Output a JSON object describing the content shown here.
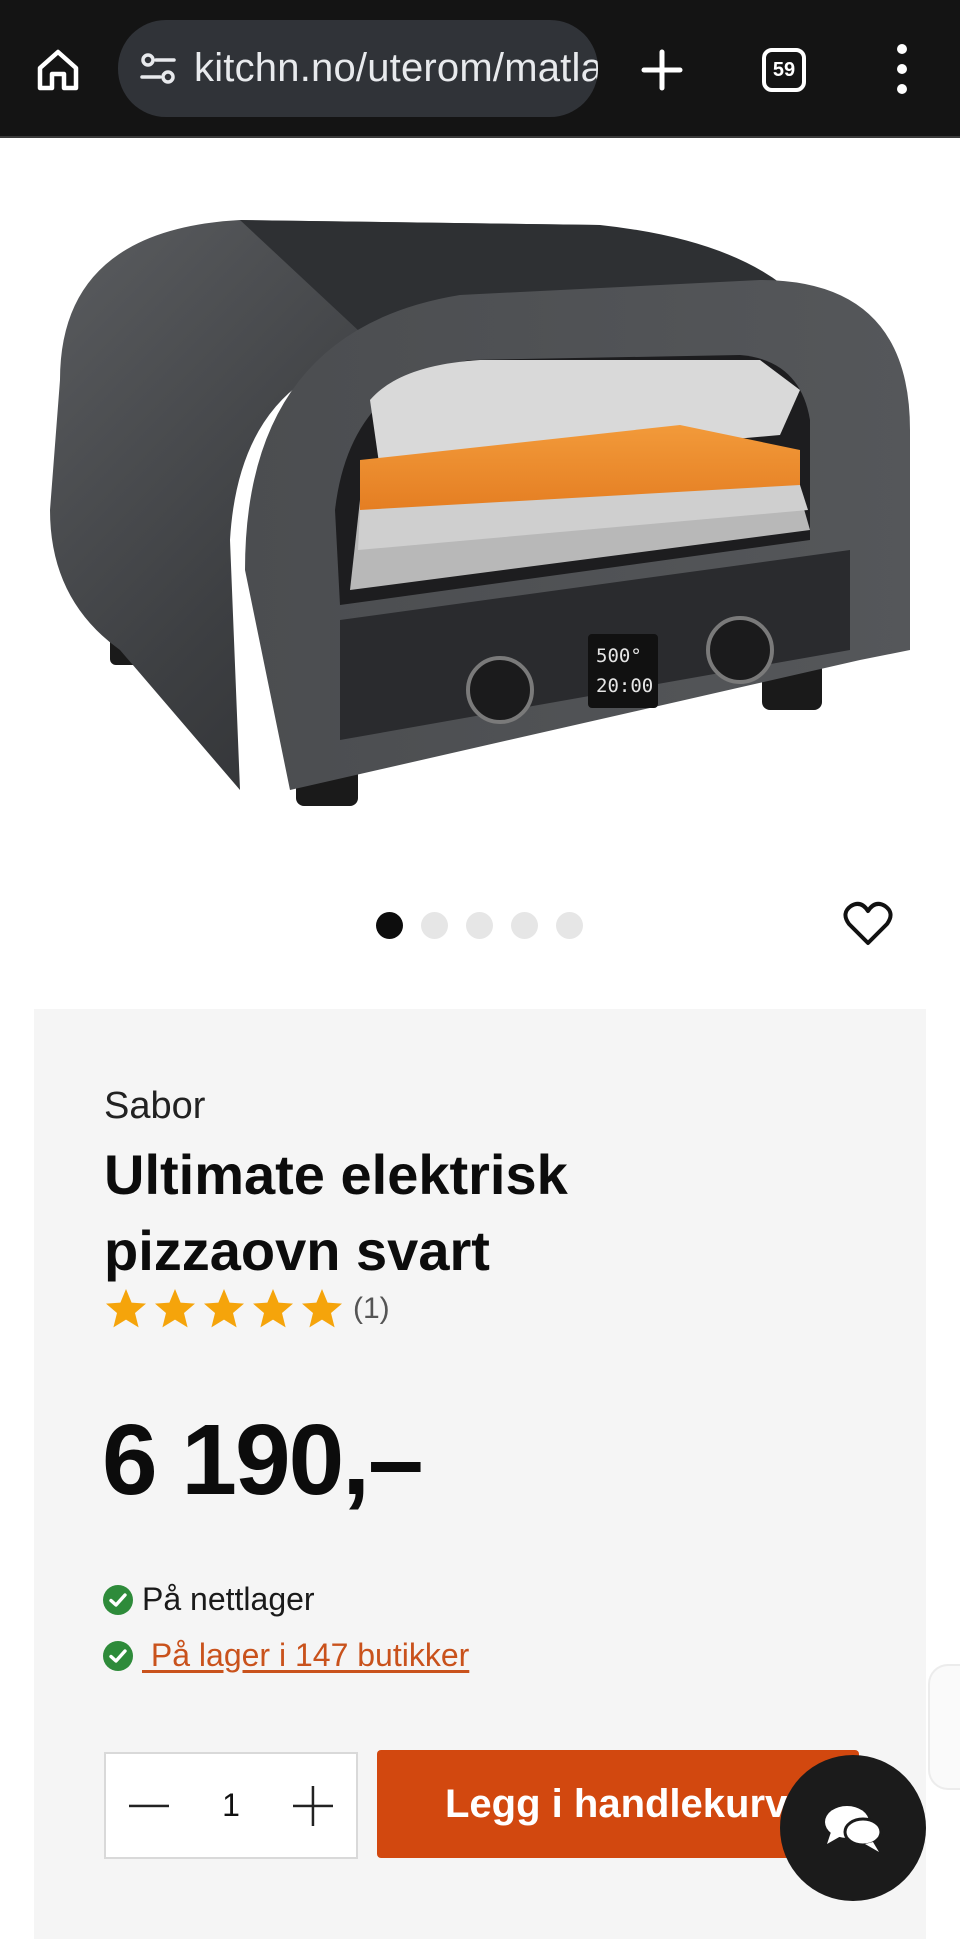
{
  "browser": {
    "url": "kitchn.no/uterom/matlaging/pizzaovner",
    "tab_count": "59",
    "icons": {
      "home": "home-icon",
      "site_info": "site-info-icon",
      "new_tab": "plus-icon",
      "tabs": "tab-switcher-icon",
      "menu": "more-vertical-icon"
    }
  },
  "product": {
    "image_alt": "pizza-oven-image",
    "brand": "Sabor",
    "title": "Ultimate elektrisk pizzaovn svart",
    "rating": 5,
    "rating_count": "(1)",
    "price": "6 190,–",
    "stock_online": "På nettlager",
    "stock_stores": " På lager i 147 butikker",
    "quantity": "1",
    "add_to_cart": "Legg i handlekurv",
    "oven_display": {
      "temp": "500°",
      "time": "20:00"
    }
  },
  "carousel": {
    "count": 5,
    "active": 0
  },
  "colors": {
    "accent": "#d2480f",
    "link": "#c9521c",
    "star": "#f5a40b",
    "check": "#2e8b3a",
    "panel": "#f5f5f5"
  }
}
